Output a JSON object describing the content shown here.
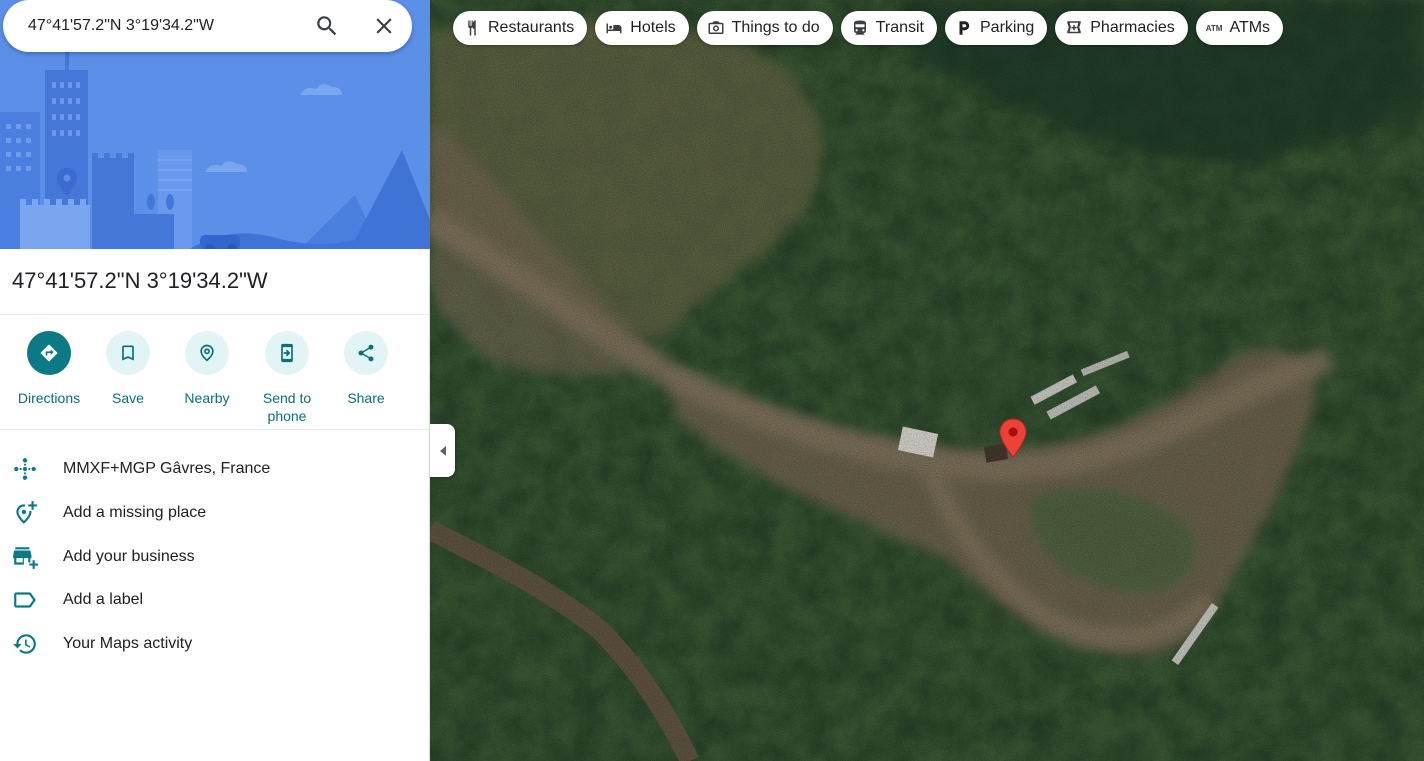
{
  "search": {
    "value": "47°41'57.2\"N 3°19'34.2\"W",
    "search_icon": "search-icon",
    "close_icon": "close-icon"
  },
  "place": {
    "title": "47°41'57.2\"N 3°19'34.2\"W"
  },
  "actions": [
    {
      "label": "Directions",
      "icon": "directions-icon"
    },
    {
      "label": "Save",
      "icon": "bookmark-icon"
    },
    {
      "label": "Nearby",
      "icon": "nearby-icon"
    },
    {
      "label": "Send to\nphone",
      "line1": "Send to",
      "line2": "phone",
      "icon": "send-to-phone-icon"
    },
    {
      "label": "Share",
      "icon": "share-icon"
    }
  ],
  "details": [
    {
      "text": "MMXF+MGP Gâvres, France",
      "icon": "plus-code-icon"
    },
    {
      "text": "Add a missing place",
      "icon": "add-place-icon"
    },
    {
      "text": "Add your business",
      "icon": "add-business-icon"
    },
    {
      "text": "Add a label",
      "icon": "label-icon"
    },
    {
      "text": "Your Maps activity",
      "icon": "history-icon"
    }
  ],
  "chips": [
    {
      "label": "Restaurants",
      "icon": "restaurant-icon"
    },
    {
      "label": "Hotels",
      "icon": "hotel-icon"
    },
    {
      "label": "Things to do",
      "icon": "camera-icon"
    },
    {
      "label": "Transit",
      "icon": "transit-icon"
    },
    {
      "label": "Parking",
      "icon": "parking-icon"
    },
    {
      "label": "Pharmacies",
      "icon": "pharmacy-icon"
    },
    {
      "label": "ATMs",
      "icon": "atm-icon",
      "glyph": "ATM"
    }
  ],
  "colors": {
    "accent": "#0b7a84",
    "action_bg": "#e3f4f7",
    "pin": "#ea4335",
    "hero": "#5a8ce6"
  }
}
